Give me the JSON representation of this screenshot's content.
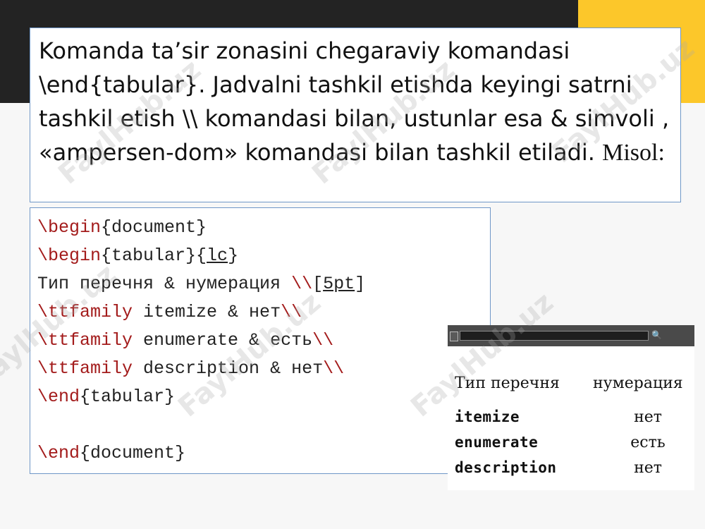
{
  "slide": {
    "paragraph_text": "Komanda ta’sir zonasini chegaraviy komandasi \\end{tabular}. Jadvalni tashkil etishda keyingi satrni tashkil etish \\\\ komandasi bilan, ustunlar esa & simvoli , «ampersen-dom» komandasi bilan tashkil etiladi.",
    "paragraph_suffix": "Misol:"
  },
  "code": {
    "l1_cmd": "\\begin",
    "l1_arg": "{document}",
    "l2_cmd": "\\begin",
    "l2_arg1": "{tabular}{",
    "l2_arg2": "lc",
    "l2_arg3": "}",
    "l3_text": "Тип перечня & нумерация ",
    "l3_cmd": "\\\\",
    "l3_a": "[",
    "l3_b": "5pt",
    "l3_c": "]",
    "l4_cmd": "\\ttfamily",
    "l4_text": " itemize & нет",
    "l4_end": "\\\\",
    "l5_cmd": "\\ttfamily",
    "l5_text": " enumerate & есть",
    "l5_end": "\\\\",
    "l6_cmd": "\\ttfamily",
    "l6_text": " description & нет",
    "l6_end": "\\\\",
    "l7_cmd": "\\end",
    "l7_arg": "{tabular}",
    "l9_cmd": "\\end",
    "l9_arg": "{document}"
  },
  "preview": {
    "search_symbol": "🔍",
    "header_col1": "Тип перечня",
    "header_col2": "нумерация",
    "rows": [
      {
        "name": "itemize",
        "value": "нет"
      },
      {
        "name": "enumerate",
        "value": "есть"
      },
      {
        "name": "description",
        "value": "нет"
      }
    ]
  },
  "watermark": {
    "text": "FaylHub.uz"
  },
  "colors": {
    "dark_band": "#232323",
    "accent_yellow": "#fcc72a",
    "border_blue": "#6f97c7",
    "latex_command": "#a31b1b"
  }
}
